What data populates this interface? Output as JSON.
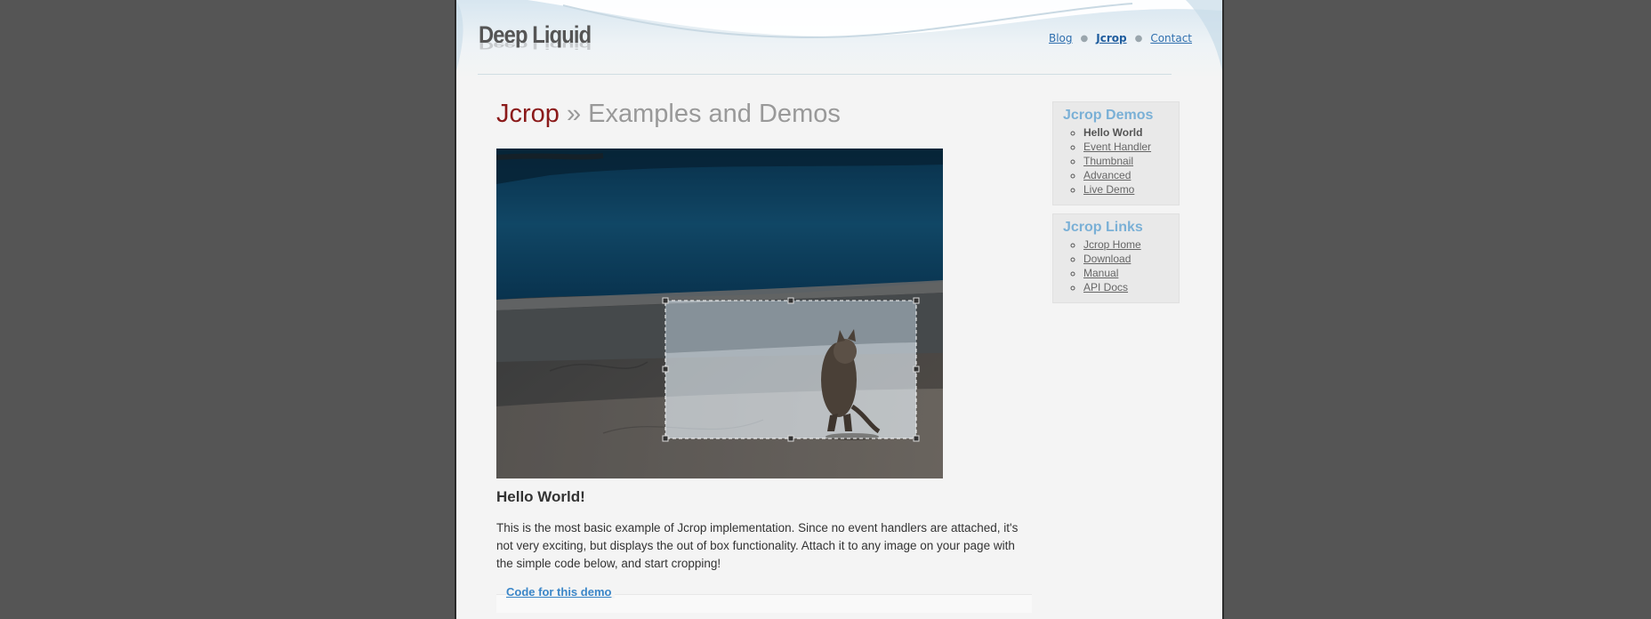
{
  "header": {
    "logo": "Deep Liquid",
    "nav": [
      {
        "label": "Blog",
        "active": false
      },
      {
        "label": "Jcrop",
        "active": true
      },
      {
        "label": "Contact",
        "active": false
      }
    ]
  },
  "page": {
    "title_brand": "Jcrop",
    "title_rest": " » Examples and Demos"
  },
  "content": {
    "heading": "Hello World!",
    "paragraph": "This is the most basic example of Jcrop implementation. Since no event handlers are attached, it's not very exciting, but displays the out of box functionality. Attach it to any image on your page with the simple code below, and start cropping!",
    "code_link": "Code for this demo"
  },
  "sidebar": {
    "demos": {
      "title": "Jcrop Demos",
      "items": [
        "Hello World",
        "Event Handler",
        "Thumbnail",
        "Advanced",
        "Live Demo"
      ],
      "current": "Hello World"
    },
    "links": {
      "title": "Jcrop Links",
      "items": [
        "Jcrop Home",
        "Download",
        "Manual",
        "API Docs"
      ]
    }
  },
  "colors": {
    "brand": "#8b1a1a",
    "link": "#2f6fae",
    "sidebar_title": "#7ab0d6",
    "backdrop": "#555555"
  }
}
